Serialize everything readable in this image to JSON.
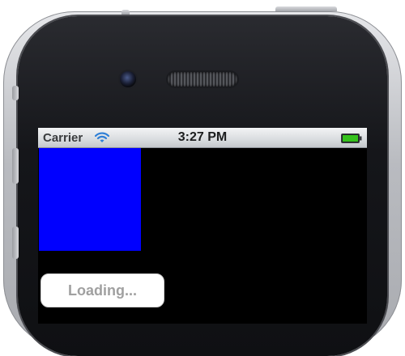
{
  "device": {
    "camera_icon": "front-camera-icon",
    "speaker_icon": "earpiece-speaker-icon"
  },
  "status_bar": {
    "carrier": "Carrier",
    "wifi_icon": "wifi-icon",
    "time": "3:27 PM",
    "battery_icon": "battery-full-icon",
    "battery_color": "#35c21c"
  },
  "content": {
    "square_color": "#0000ff",
    "loading_button_label": "Loading..."
  }
}
